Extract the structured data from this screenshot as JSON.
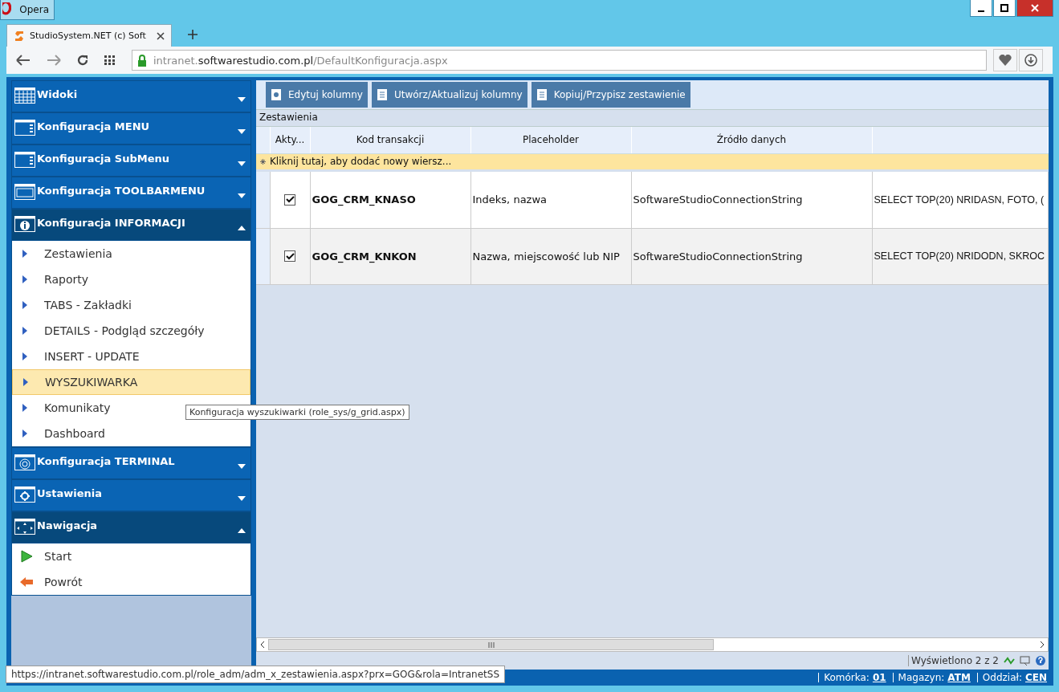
{
  "browser": {
    "app_title": "Opera",
    "tab": {
      "title": "StudioSystem.NET (c) Soft"
    },
    "url": {
      "prefix": "intranet.",
      "domain": "softwarestudio.com.pl",
      "path": "/DefaultKonfiguracja.aspx"
    }
  },
  "sidebar": {
    "sections": [
      {
        "title": "Widoki",
        "expanded": false
      },
      {
        "title": "Konfiguracja MENU",
        "expanded": false
      },
      {
        "title": "Konfiguracja SubMenu",
        "expanded": false
      },
      {
        "title": "Konfiguracja TOOLBARMENU",
        "expanded": false
      },
      {
        "title": "Konfiguracja INFORMACJI",
        "expanded": true,
        "children": [
          {
            "label": "Zestawienia",
            "kind": "link",
            "selected": false
          },
          {
            "label": "Raporty",
            "kind": "link",
            "selected": false
          },
          {
            "label": "TABS - Zakładki",
            "kind": "link",
            "selected": false
          },
          {
            "label": "DETAILS - Podgląd szczegóły",
            "kind": "link",
            "selected": false
          },
          {
            "label": "INSERT - UPDATE",
            "kind": "link",
            "selected": false
          },
          {
            "label": "WYSZUKIWARKA",
            "kind": "link",
            "selected": true
          },
          {
            "label": "Komunikaty",
            "kind": "link",
            "selected": false
          },
          {
            "label": "Dashboard",
            "kind": "link",
            "selected": false
          }
        ]
      },
      {
        "title": "Konfiguracja TERMINAL",
        "expanded": false
      },
      {
        "title": "Ustawienia",
        "expanded": false
      },
      {
        "title": "Nawigacja",
        "expanded": true,
        "children": [
          {
            "label": "Start",
            "kind": "start",
            "selected": false
          },
          {
            "label": "Powrót",
            "kind": "back",
            "selected": false
          }
        ]
      }
    ]
  },
  "toolbar": {
    "buttons": [
      "Edytuj kolumny",
      "Utwórz/Aktualizuj kolumny",
      "Kopiuj/Przypisz zestawienie"
    ]
  },
  "grid": {
    "title": "Zestawienia",
    "columns": [
      "Akty...",
      "Kod transakcji",
      "Placeholder",
      "Źródło danych"
    ],
    "new_row_hint": "Kliknij tutaj, aby dodać nowy wiersz...",
    "rows": [
      {
        "active": true,
        "code": "GOG_CRM_KNASO",
        "placeholder": "Indeks, nazwa",
        "source": "SoftwareStudioConnectionString",
        "column_5": "SELECT TOP(20) NRIDASN, FOTO, ("
      },
      {
        "active": true,
        "code": "GOG_CRM_KNKON",
        "placeholder": "Nazwa, miejscowość lub NIP",
        "source": "SoftwareStudioConnectionString",
        "column_5": "SELECT TOP(20) NRIDODN, SKROC"
      }
    ],
    "pager": "Wyświetlono 2 z 2"
  },
  "tooltip": "Konfiguracja wyszukiwarki (role_sys/g_grid.aspx)",
  "link_preview": "https://intranet.softwarestudio.com.pl/role_adm/adm_x_zestawienia.aspx?prx=GOG&rola=IntranetSS",
  "status_bar": [
    {
      "label": "Komórka:",
      "value": "01"
    },
    {
      "label": "Magazyn:",
      "value": "ATM"
    },
    {
      "label": "Oddział:",
      "value": "CEN"
    }
  ]
}
